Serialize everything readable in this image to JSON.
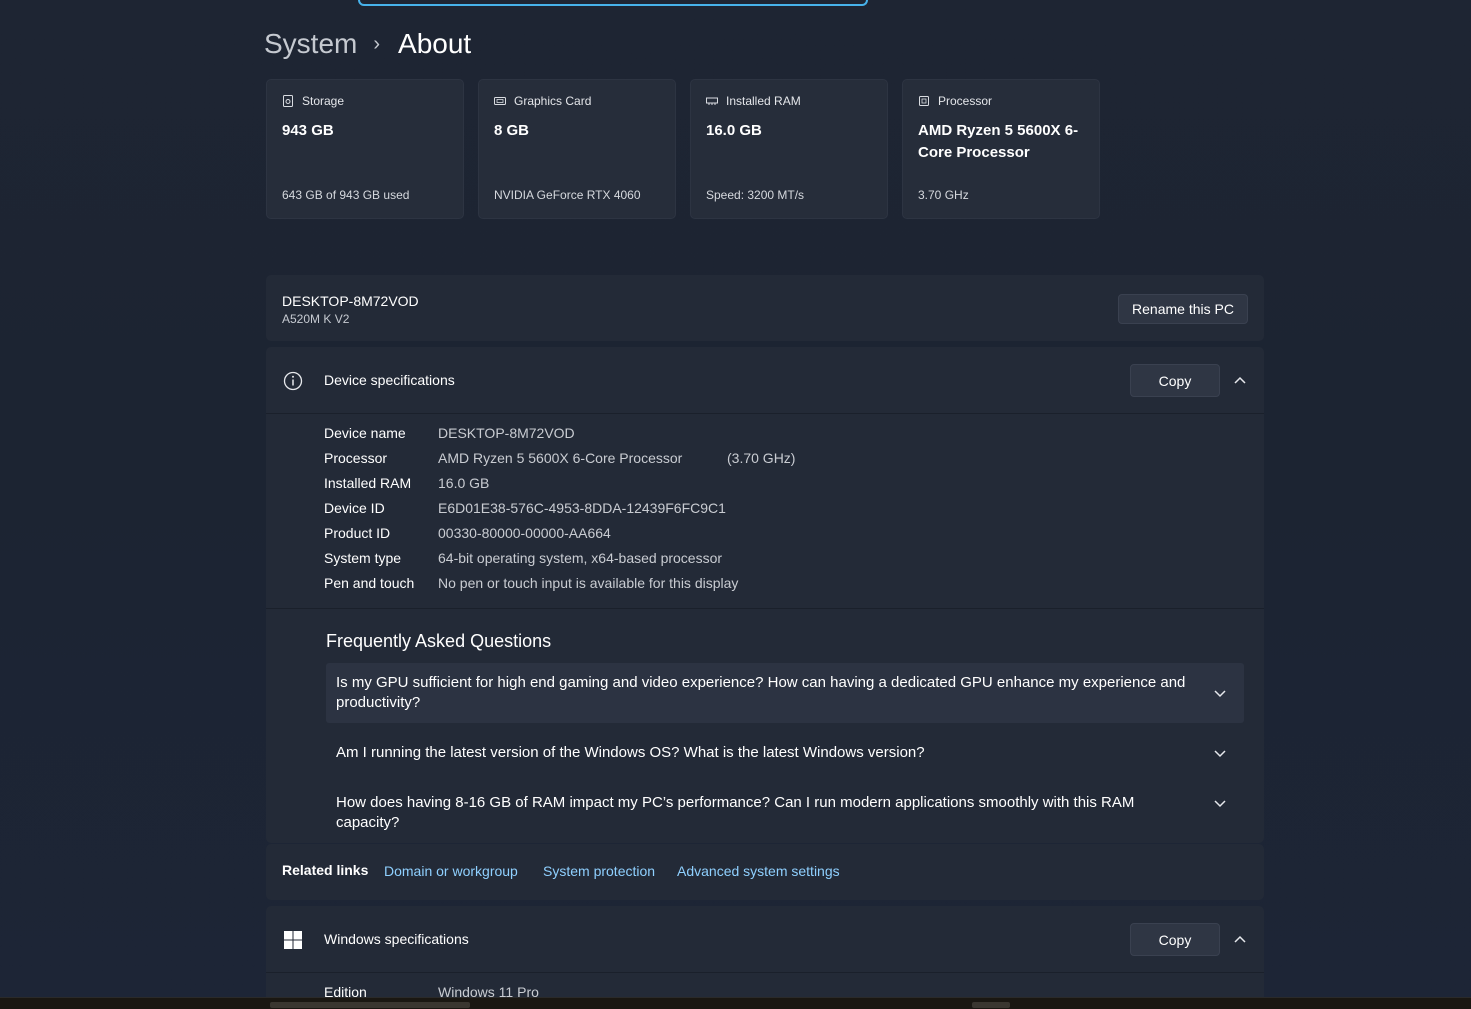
{
  "breadcrumb": {
    "parent": "System",
    "separator": "›",
    "current": "About"
  },
  "cards": [
    {
      "label": "Storage",
      "value": "943 GB",
      "sub": "643 GB of 943 GB used",
      "icon": "storage-icon"
    },
    {
      "label": "Graphics Card",
      "value": "8 GB",
      "sub": "NVIDIA GeForce RTX 4060",
      "icon": "graphics-card-icon"
    },
    {
      "label": "Installed RAM",
      "value": "16.0 GB",
      "sub": "Speed: 3200 MT/s",
      "icon": "ram-icon"
    },
    {
      "label": "Processor",
      "value": "AMD Ryzen 5 5600X 6-Core Processor",
      "sub": "3.70 GHz",
      "icon": "processor-icon"
    }
  ],
  "pc": {
    "name": "DESKTOP-8M72VOD",
    "model": "A520M K V2",
    "rename_label": "Rename this PC"
  },
  "device_specs": {
    "title": "Device specifications",
    "copy_label": "Copy",
    "rows": [
      {
        "label": "Device name",
        "value": "DESKTOP-8M72VOD"
      },
      {
        "label": "Processor",
        "value": "AMD Ryzen 5 5600X 6-Core Processor",
        "extra": "(3.70 GHz)"
      },
      {
        "label": "Installed RAM",
        "value": "16.0 GB"
      },
      {
        "label": "Device ID",
        "value": "E6D01E38-576C-4953-8DDA-12439F6FC9C1"
      },
      {
        "label": "Product ID",
        "value": "00330-80000-00000-AA664"
      },
      {
        "label": "System type",
        "value": "64-bit operating system, x64-based processor"
      },
      {
        "label": "Pen and touch",
        "value": "No pen or touch input is available for this display"
      }
    ]
  },
  "faq": {
    "title": "Frequently Asked Questions",
    "items": [
      "Is my GPU sufficient for high end gaming and video experience? How can having a dedicated GPU enhance my experience and productivity?",
      "Am I running the latest version of the Windows OS? What is the latest Windows version?",
      "How does having 8-16 GB of RAM impact my PC’s performance? Can I run modern applications smoothly with this RAM capacity?"
    ]
  },
  "related_links": {
    "label": "Related links",
    "links": [
      "Domain or workgroup",
      "System protection",
      "Advanced system settings"
    ]
  },
  "windows_specs": {
    "title": "Windows specifications",
    "copy_label": "Copy",
    "rows": [
      {
        "label": "Edition",
        "value": "Windows 11 Pro"
      }
    ]
  },
  "colors": {
    "accent": "#4cc2ff",
    "link": "#8fd0ff",
    "background": "#1e2533",
    "card": "#262d3a"
  }
}
